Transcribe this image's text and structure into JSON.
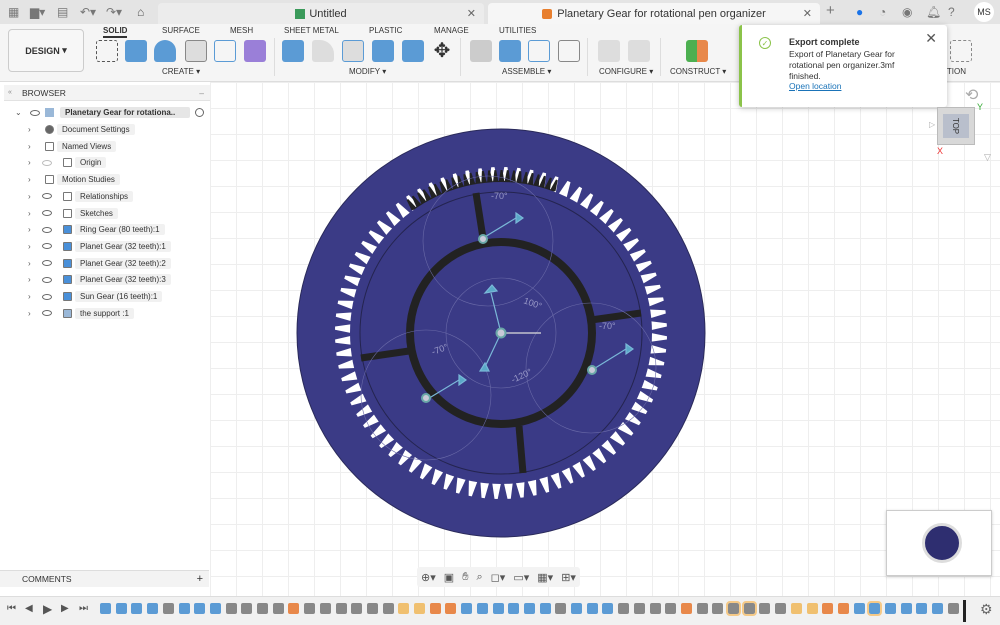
{
  "titlebar": {
    "tabs": [
      {
        "label": "Untitled"
      },
      {
        "label": "Planetary Gear for rotational pen organizer"
      }
    ],
    "user_initials": "MS"
  },
  "ribbon": {
    "workspace": "DESIGN",
    "tabs": [
      "SOLID",
      "SURFACE",
      "MESH",
      "SHEET METAL",
      "PLASTIC",
      "MANAGE",
      "UTILITIES"
    ],
    "active_tab": "SOLID",
    "groups": [
      "CREATE",
      "MODIFY",
      "ASSEMBLE",
      "CONFIGURE",
      "CONSTRUCT",
      "INSPECTION"
    ]
  },
  "notification": {
    "title": "Export complete",
    "message": "Export of Planetary Gear for rotational pen organizer.3mf finished.",
    "link": "Open location",
    "accent": "#8bc34a"
  },
  "browser": {
    "title": "BROWSER",
    "root": "Planetary Gear for rotationa..",
    "items": [
      {
        "label": "Document Settings",
        "icon": "gear-icon",
        "eye": false
      },
      {
        "label": "Named Views",
        "icon": "folder-icon",
        "eye": false
      },
      {
        "label": "Origin",
        "icon": "folder-icon",
        "eye": "hidden"
      },
      {
        "label": "Motion Studies",
        "icon": "folder-icon",
        "eye": false
      },
      {
        "label": "Relationships",
        "icon": "folder-icon",
        "eye": true
      },
      {
        "label": "Sketches",
        "icon": "folder-icon",
        "eye": true
      },
      {
        "label": "Ring Gear (80 teeth):1",
        "icon": "component-icon",
        "eye": true
      },
      {
        "label": "Planet Gear (32 teeth):1",
        "icon": "body-icon",
        "eye": true
      },
      {
        "label": "Planet Gear (32 teeth):2",
        "icon": "body-icon",
        "eye": true
      },
      {
        "label": "Planet Gear (32 teeth):3",
        "icon": "body-icon",
        "eye": true
      },
      {
        "label": "Sun Gear (16 teeth):1",
        "icon": "body-icon",
        "eye": true
      },
      {
        "label": "the support :1",
        "icon": "assembly-icon",
        "eye": true
      }
    ]
  },
  "comments": {
    "label": "COMMENTS"
  },
  "viewcube": {
    "face": "TOP",
    "x": "X",
    "y": "Y"
  },
  "model": {
    "angles": [
      "-70°",
      "100°",
      "-70°",
      "-70°",
      "-120°"
    ],
    "colors": {
      "body": "#3b3b86",
      "teeth": "#ffffff",
      "dark": "#222"
    }
  }
}
